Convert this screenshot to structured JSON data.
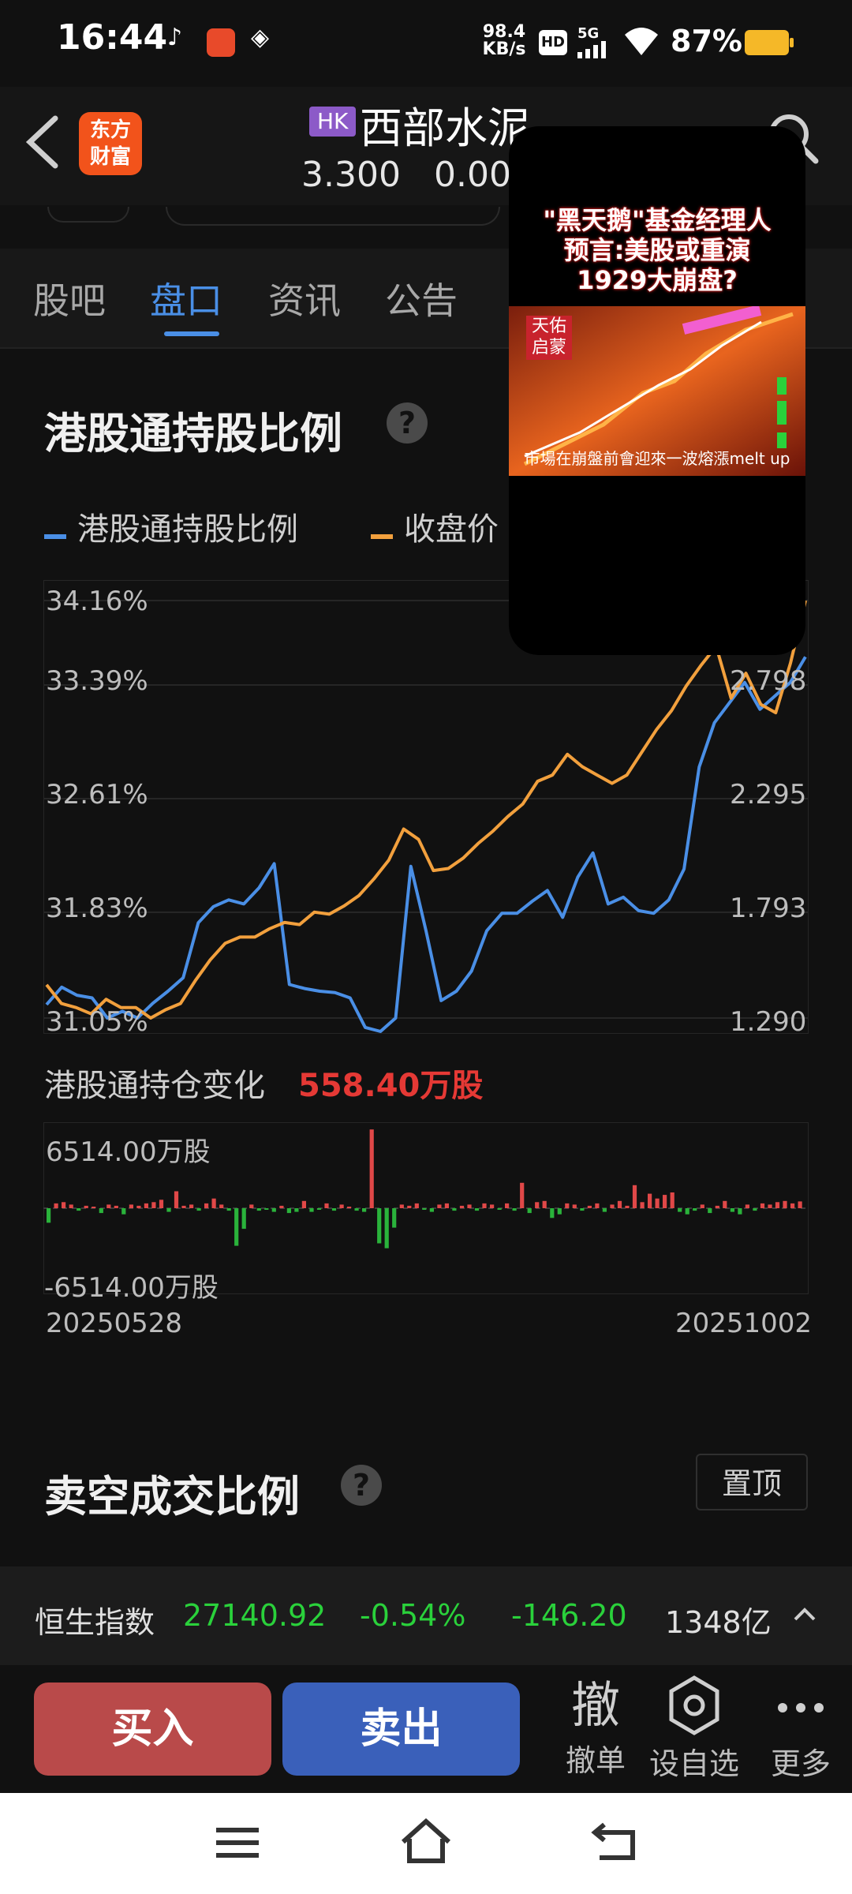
{
  "status_bar": {
    "time": "16:44",
    "net_speed_value": "98.4",
    "net_speed_unit": "KB/s",
    "hd_label": "HD",
    "signal_label": "5G",
    "battery": "87%"
  },
  "header": {
    "logo_text_line1": "东方",
    "logo_text_line2": "财富",
    "market_badge": "HK",
    "stock_name": "西部水泥",
    "price": "3.300",
    "change": "0.00"
  },
  "tabs": [
    {
      "label": "股吧",
      "active": false
    },
    {
      "label": "盘口",
      "active": true
    },
    {
      "label": "资讯",
      "active": false
    },
    {
      "label": "公告",
      "active": false
    }
  ],
  "holding_section": {
    "title": "港股通持股比例",
    "legend": [
      {
        "label": "港股通持股比例",
        "color": "#4a8fe6"
      },
      {
        "label": "收盘价",
        "color": "#f2a03d"
      }
    ],
    "left_ticks": [
      "34.16%",
      "33.39%",
      "32.61%",
      "31.83%",
      "31.05%"
    ],
    "right_ticks": [
      "2.798",
      "2.295",
      "1.793",
      "1.290"
    ],
    "change_label": "港股通持仓变化",
    "change_value": "558.40万股",
    "bar_axis_top": "6514.00万股",
    "bar_axis_bottom": "-6514.00万股",
    "date_start": "20250528",
    "date_end": "20251002"
  },
  "chart_data": [
    {
      "type": "line",
      "title": "港股通持股比例",
      "x_range": [
        "20250528",
        "20251002"
      ],
      "series": [
        {
          "name": "港股通持股比例",
          "axis": "left",
          "ylim": [
            31.05,
            34.16
          ],
          "values": [
            31.15,
            31.28,
            31.22,
            31.2,
            31.05,
            31.1,
            31.05,
            31.16,
            31.25,
            31.35,
            31.76,
            31.88,
            31.93,
            31.9,
            32.02,
            32.2,
            31.3,
            31.27,
            31.25,
            31.24,
            31.2,
            30.98,
            30.95,
            31.05,
            32.18,
            31.7,
            31.18,
            31.25,
            31.4,
            31.7,
            31.83,
            31.83,
            31.92,
            32.0,
            31.8,
            32.1,
            32.28,
            31.9,
            31.95,
            31.85,
            31.83,
            31.93,
            32.16,
            32.92,
            33.25,
            33.4,
            33.55,
            33.35,
            33.45,
            33.55,
            33.74
          ]
        },
        {
          "name": "收盘价",
          "axis": "right",
          "ylim": [
            1.29,
            3.3
          ],
          "values": [
            1.45,
            1.36,
            1.34,
            1.31,
            1.38,
            1.34,
            1.34,
            1.29,
            1.33,
            1.36,
            1.47,
            1.57,
            1.65,
            1.68,
            1.68,
            1.72,
            1.75,
            1.74,
            1.8,
            1.79,
            1.83,
            1.88,
            1.96,
            2.05,
            2.2,
            2.15,
            2.0,
            2.01,
            2.06,
            2.13,
            2.19,
            2.26,
            2.32,
            2.43,
            2.46,
            2.56,
            2.5,
            2.46,
            2.42,
            2.46,
            2.57,
            2.68,
            2.77,
            2.89,
            2.99,
            3.08,
            2.83,
            2.95,
            2.8,
            2.76,
            3.0,
            3.3
          ]
        }
      ]
    },
    {
      "type": "bar",
      "title": "港股通持仓变化",
      "ylabel": "万股",
      "ylim": [
        -6514.0,
        6514.0
      ],
      "x_range": [
        "20250528",
        "20251002"
      ],
      "values": [
        -1200,
        400,
        500,
        300,
        -200,
        200,
        100,
        -400,
        300,
        200,
        -500,
        300,
        200,
        400,
        500,
        700,
        -300,
        1400,
        200,
        300,
        -200,
        400,
        800,
        300,
        -200,
        -3100,
        -1700,
        300,
        -200,
        -100,
        -300,
        200,
        -400,
        -300,
        600,
        -300,
        -100,
        400,
        -200,
        300,
        100,
        -200,
        -300,
        6500,
        -2900,
        -3300,
        -1600,
        300,
        200,
        400,
        -100,
        -300,
        300,
        400,
        -200,
        200,
        300,
        -200,
        400,
        300,
        -100,
        400,
        -200,
        2100,
        -400,
        500,
        600,
        -800,
        -500,
        400,
        300,
        -200,
        200,
        400,
        -300,
        300,
        600,
        200,
        1900,
        500,
        1200,
        800,
        1100,
        1300,
        -300,
        -500,
        -200,
        300,
        -400,
        200,
        600,
        -300,
        -500,
        300,
        -200,
        400,
        300,
        500,
        600,
        400,
        558.4
      ]
    }
  ],
  "short_section": {
    "title": "卖空成交比例",
    "pin_label": "置顶"
  },
  "index_bar": {
    "name": "恒生指数",
    "value": "27140.92",
    "pct": "-0.54%",
    "change": "-146.20",
    "turnover": "1348亿"
  },
  "actions": {
    "buy": "买入",
    "sell": "卖出",
    "cancel_glyph": "撤",
    "cancel_label": "撤单",
    "watch_label": "设自选",
    "more_label": "更多"
  },
  "overlay_video": {
    "title_line1": "\"黑天鹅\"基金经理人",
    "title_line2": "预言:美股或重演",
    "title_line3": "1929大崩盘?",
    "tag_line1": "天佑",
    "tag_line2": "启蒙",
    "caption": "市場在崩盤前會迎來一波熔漲melt up"
  }
}
